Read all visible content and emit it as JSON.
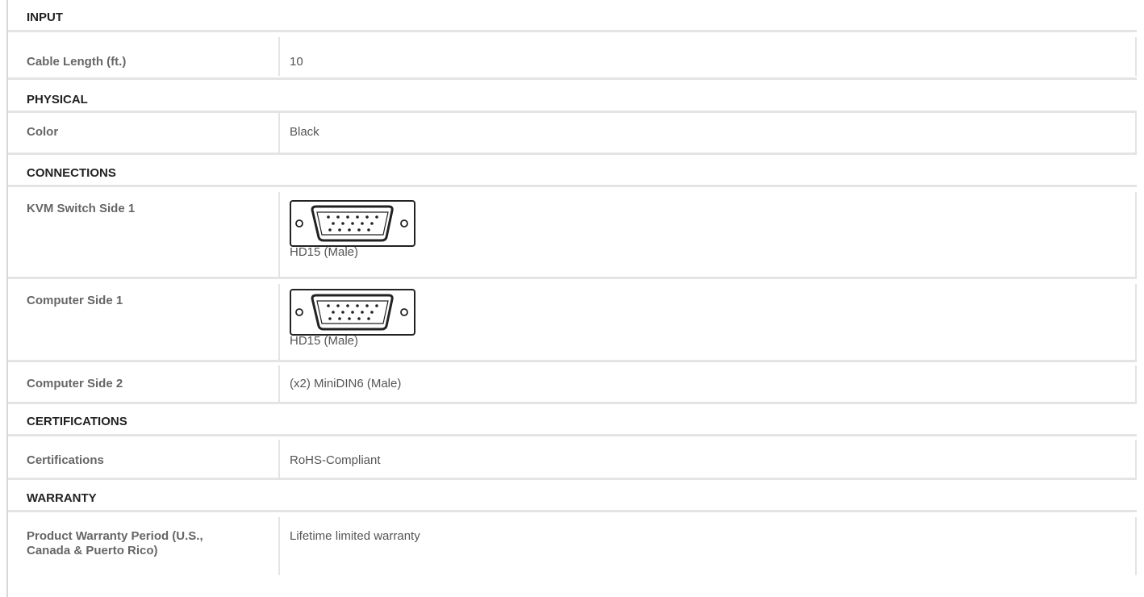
{
  "sections": [
    {
      "title": "INPUT",
      "rows": [
        {
          "label": "Cable Length (ft.)",
          "value": "10"
        }
      ]
    },
    {
      "title": "PHYSICAL",
      "rows": [
        {
          "label": "Color",
          "value": "Black"
        }
      ]
    },
    {
      "title": "CONNECTIONS",
      "rows": [
        {
          "label": "KVM Switch Side 1",
          "value": "HD15 (Male)",
          "icon": "vga-connector-icon"
        },
        {
          "label": "Computer Side 1",
          "value": "HD15 (Male)",
          "icon": "vga-connector-icon"
        },
        {
          "label": "Computer Side 2",
          "value": "(x2) MiniDIN6 (Male)"
        }
      ]
    },
    {
      "title": "CERTIFICATIONS",
      "rows": [
        {
          "label": "Certifications",
          "value": "RoHS-Compliant"
        }
      ]
    },
    {
      "title": "WARRANTY",
      "rows": [
        {
          "label": "Product Warranty Period (U.S., Canada & Puerto Rico)",
          "value": "Lifetime limited warranty"
        }
      ]
    }
  ]
}
